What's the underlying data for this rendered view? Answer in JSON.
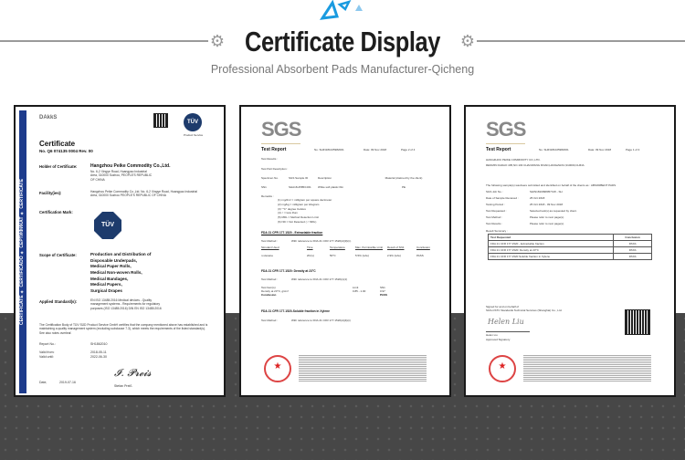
{
  "header": {
    "title": "Certificate Display",
    "subtitle": "Professional Absorbent Pads Manufacturer-Qicheng",
    "accent": "#1a9be0"
  },
  "cert1": {
    "stripe": "CERTIFICATE ✦ CERTIFICADO ✦ СЕРТИФИКАТ ✦ CERTIFICATE",
    "dakks": "DAkkS",
    "tuv": "TÜV",
    "tuv_caption": "Product Service",
    "title": "Certificate",
    "number": "No. Q6 074135 0004 Rev. 00",
    "holder_label": "Holder of Certificate:",
    "holder_name": "Hangzhou Peike Commodity Co.,Ltd.",
    "holder_addr": "No. 6-2 Xingye Road, Huangyao Industrial Area, 310000 Suzhou, PEOPLE'S REPUBLIC OF CHINA",
    "facility_label": "Facility(ies):",
    "facility_text": "Hangzhou Peike Commodity Co.,Ltd. No. 6-2 Xingye Road, Huangyao Industrial Area, 310000 Suzhou PEOPLE'S REPUBLIC OF CHINA",
    "mark_label": "Certification Mark:",
    "scope_label": "Scope of Certificate:",
    "scope": [
      "Production and Distribution of",
      "Disposable Underpads,",
      "Medical Paper Rolls,",
      "Medical Non-woven Rolls,",
      "Medical Bandages,",
      "Medical Papers,",
      "Surgical Drapes"
    ],
    "standards_label": "Applied Standard(s):",
    "standards_text": "EN ISO 13485:2016 Medical devices - Quality management systems - Requirements for regulatory purposes (ISO 13485:2016) DIN EN ISO 13485:2016",
    "statement": "The Certification Body of TÜV SÜD Product Service GmbH certifies that the company mentioned above has established and is maintaining a quality management system (excluding subclause 7.3), which meets the requirements of the listed standard(s). See also notes overleaf.",
    "report_label": "Report No.:",
    "report": "SH1862010",
    "valid_from_label": "Valid from:",
    "valid_from": "2018-05-11",
    "valid_until_label": "Valid until:",
    "valid_until": "2022-06-30",
    "date_label": "Date,",
    "date": "2019-07-16",
    "signer": "Stefan Preiß"
  },
  "cert2": {
    "logo": "SGS",
    "title": "Test Report",
    "no": "No. SHIN181025982001",
    "date": "Date: 09 Nov 2018",
    "page": "Page 2 of 4",
    "results_label": "Test Results :",
    "part_label": "Test Part Description :",
    "headers": [
      "Specimen No.",
      "SGS Sample ID",
      "Description",
      "Material (claimed by the client)"
    ],
    "row": [
      "SN1",
      "SHA18-25853.001",
      "White soft plastic film",
      "PE"
    ],
    "remarks_label": "Remarks :",
    "remarks": [
      "(1) mg/dm² = milligram per square decimeter",
      "(2) mg/kg = milligram per kilogram",
      "(3) \"°C\" degree Celsius",
      "(4) < = less than",
      "(5) MDL = Method Detection Limit",
      "(6) ND = Not Detected ( < MDL)"
    ],
    "sec1": "FDA 21 CFR 177.1520 - Extractable fraction",
    "method_label": "Test Method :",
    "method1": "With reference to FDA 21 CFR 177.1520(d)(3)(ii).",
    "t1_headers": [
      "Simulant Used",
      "Time",
      "Temperature",
      "Max. Permissible Limit",
      "Result of SN1",
      "Conclusion"
    ],
    "t1_row": [
      "n-Hexane",
      "2hr(s)",
      "50°C",
      "5.5% (w/w)",
      "2.9% (w/w)",
      "PASS"
    ],
    "sec2": "FDA 21 CFR 177.1520: Density at 23°C",
    "method2": "With reference to FDA 21 CFR 177.1520(c)(1)",
    "t2_headers": [
      "Test Item(s)",
      "Limit",
      "SN1"
    ],
    "t2_row": [
      "Density at 23°C, g/cm³",
      "0.85 - 1.00",
      "0.97"
    ],
    "conclusion_label": "Conclusion",
    "conclusion": "PASS",
    "sec3": "FDA 21 CFR 177.1520-Soluble fraction in Xylene",
    "method3": "With reference to FDA 21 CFR 177.1520(d)(4)(ii)"
  },
  "cert3": {
    "logo": "SGS",
    "title": "Test Report",
    "no": "No. SHIN181025982001",
    "date": "Date: 09 Nov 2018",
    "page": "Page 1 of 4",
    "client": "HANGZHOU PEIKE COMMODITY CO.,LTD.",
    "client_addr": "RENMIN DADAO 405,NO.103 CHAOWANG ROAD,HANGZHOU,310000,CHINA",
    "intro": "The following sample(s) was/were submitted and identified on behalf of the clients as : ABSORBENT PADS",
    "fields": [
      {
        "label": "SGS Job No. :",
        "value": "SHIN1810998057CW - SH"
      },
      {
        "label": "Date of Sample Received :",
        "value": "25 Oct 2018"
      },
      {
        "label": "Testing Period :",
        "value": "25 Oct 2018 - 09 Nov 2018"
      },
      {
        "label": "Test Requested :",
        "value": "Selected test(s) as requested by client."
      },
      {
        "label": "Test Method :",
        "value": "Please refer to next page(s)."
      },
      {
        "label": "Test Results :",
        "value": "Please refer to next page(s)."
      }
    ],
    "summary_label": "Result Summary :",
    "summary_headers": [
      "Test Requested",
      "Conclusion"
    ],
    "summary_rows": [
      [
        "FDA 21 CFR 177.1520 - Extractable fraction",
        "PASS"
      ],
      [
        "FDA 21 CFR 177.1520: Density at 23°C",
        "PASS"
      ],
      [
        "FDA 21 CFR 177.1520 Soluble fraction in Xylene",
        "PASS"
      ]
    ],
    "signed": "Signed for and on behalf of",
    "signed_org": "SGS-CSTC Standards Technical Services (Shanghai) Co., Ltd.",
    "signer": "Helen Liu",
    "signer_role": "Approved Signatory"
  }
}
